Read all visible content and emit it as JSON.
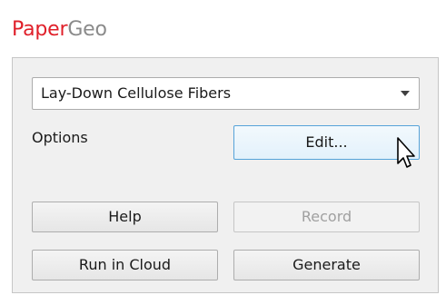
{
  "app": {
    "title_part1": "Paper",
    "title_part2": "Geo"
  },
  "panel": {
    "dropdown": {
      "selected": "Lay-Down Cellulose Fibers"
    },
    "options_label": "Options",
    "buttons": {
      "edit": "Edit...",
      "help": "Help",
      "record": "Record",
      "run_in_cloud": "Run in Cloud",
      "generate": "Generate"
    }
  },
  "colors": {
    "brand_red": "#e0202a",
    "brand_gray": "#8a8a8a",
    "focus_blue": "#56a3d9"
  },
  "icons": {
    "dropdown": "chevron-down-icon",
    "cursor": "mouse-pointer-icon"
  }
}
